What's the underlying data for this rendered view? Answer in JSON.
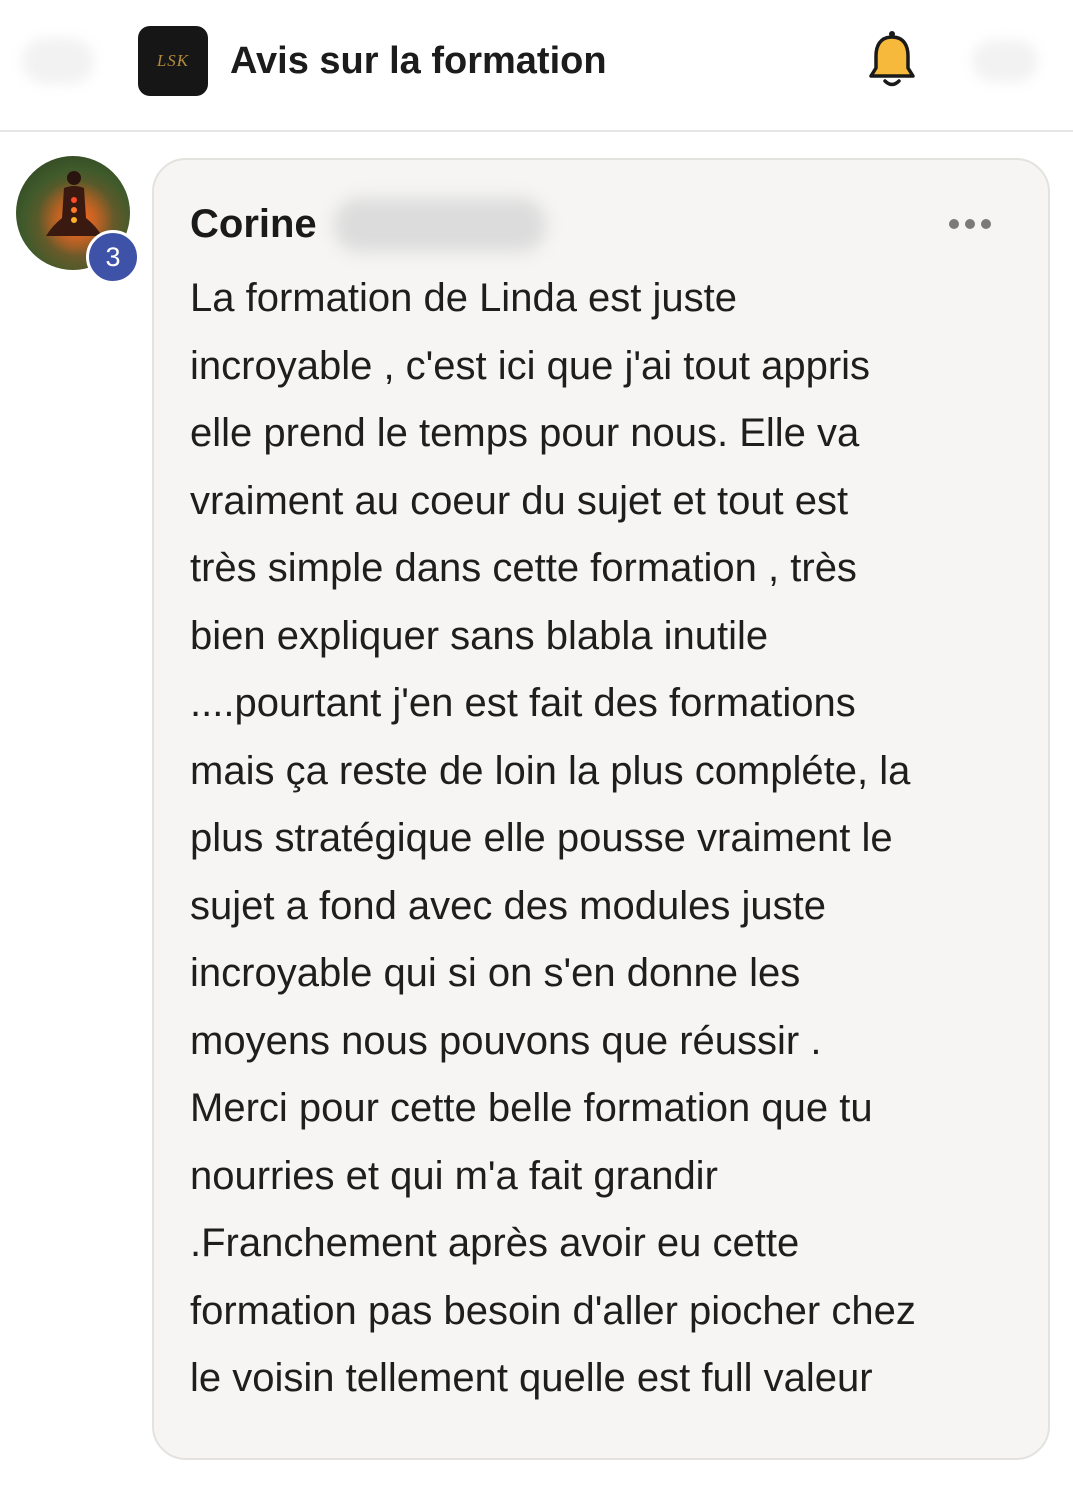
{
  "header": {
    "logo_text": "LSK",
    "title": "Avis sur la formation",
    "bell_icon": "bell-icon",
    "accent_color": "#f6b93b"
  },
  "post": {
    "author_first_name": "Corine",
    "avatar_badge": "3",
    "badge_color": "#3e52a8",
    "more_icon": "ellipsis-icon",
    "body_lines": [
      "La formation de Linda est juste",
      "incroyable , c'est ici que j'ai tout appris",
      "elle prend le temps pour nous. Elle va",
      "vraiment au coeur du sujet et tout est",
      "très simple dans cette formation , très",
      "bien expliquer sans blabla inutile",
      "....pourtant j'en est fait des formations",
      "mais ça reste de loin la plus compléte, la",
      "plus stratégique elle pousse vraiment le",
      "sujet a fond avec des modules juste",
      "incroyable qui si on s'en donne les",
      "moyens nous pouvons que réussir .",
      "Merci pour cette belle formation que tu",
      "nourries et qui m'a fait grandir",
      ".Franchement après avoir eu cette",
      "formation pas besoin d'aller piocher chez",
      "le voisin tellement quelle est full valeur"
    ]
  }
}
